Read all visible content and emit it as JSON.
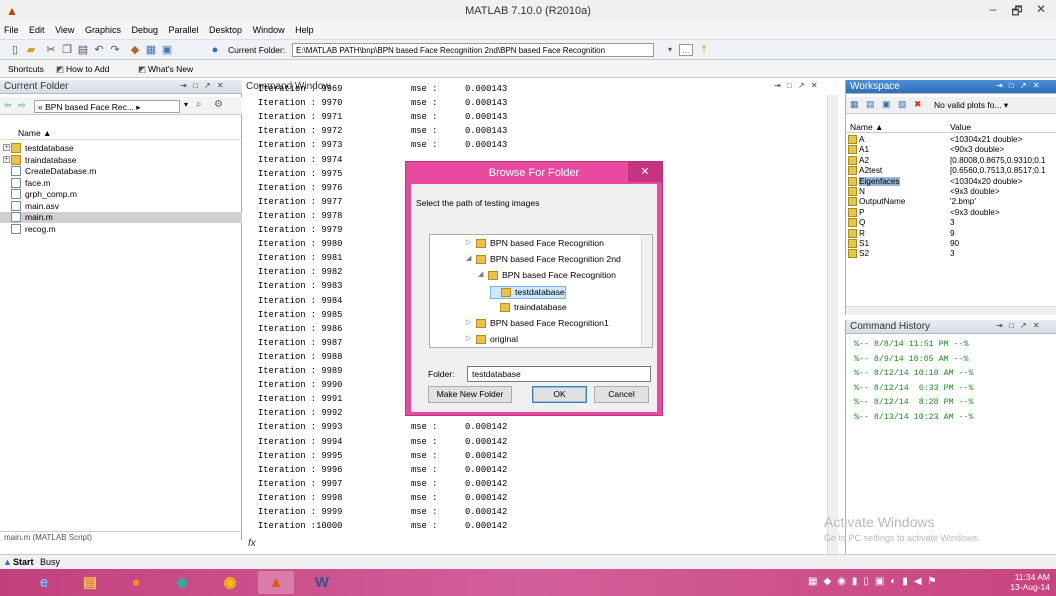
{
  "window": {
    "title": "MATLAB  7.10.0 (R2010a)",
    "controls": [
      "–",
      "🗗",
      "✕"
    ]
  },
  "menu": [
    "File",
    "Edit",
    "View",
    "Graphics",
    "Debug",
    "Parallel",
    "Desktop",
    "Window",
    "Help"
  ],
  "toolbar": {
    "current_folder_label": "Current Folder:",
    "current_folder_value": "E:\\MATLAB PATH\\bnp\\BPN based Face Recognition 2nd\\BPN based Face Recognition",
    "dropdown_icon": "▾",
    "browse_label": "...",
    "up_icon": "⤒"
  },
  "shortcuts": {
    "items": [
      "Shortcuts",
      "How to Add",
      "What's New"
    ]
  },
  "current_folder": {
    "title": "Current Folder",
    "controls": "⇥ □ ↗ ✕",
    "path": "« BPN based Face Rec... ▸",
    "column_name": "Name ▲",
    "files": [
      {
        "name": "testdatabase",
        "type": "folder",
        "expand": "+"
      },
      {
        "name": "traindatabase",
        "type": "folder",
        "expand": "+"
      },
      {
        "name": "CreateDatabase.m",
        "type": "m"
      },
      {
        "name": "face.m",
        "type": "m"
      },
      {
        "name": "grph_comp.m",
        "type": "m"
      },
      {
        "name": "main.asv",
        "type": "asv"
      },
      {
        "name": "main.m",
        "type": "m",
        "selected": true
      },
      {
        "name": "recog.m",
        "type": "m"
      }
    ],
    "status": "main.m (MATLAB Script)"
  },
  "command_window": {
    "title": "Command Window",
    "controls": "⇥ □ ↗ ✕",
    "lines": [
      [
        "Iteration : 9969",
        "mse :",
        "0.000143"
      ],
      [
        "Iteration : 9970",
        "mse :",
        "0.000143"
      ],
      [
        "Iteration : 9971",
        "mse :",
        "0.000143"
      ],
      [
        "Iteration : 9972",
        "mse :",
        "0.000143"
      ],
      [
        "Iteration : 9973",
        "mse :",
        "0.000143"
      ],
      [
        "Iteration : 9974",
        "",
        ""
      ],
      [
        "Iteration : 9975",
        "",
        ""
      ],
      [
        "Iteration : 9976",
        "",
        ""
      ],
      [
        "Iteration : 9977",
        "",
        ""
      ],
      [
        "Iteration : 9978",
        "",
        ""
      ],
      [
        "Iteration : 9979",
        "",
        ""
      ],
      [
        "Iteration : 9980",
        "",
        ""
      ],
      [
        "Iteration : 9981",
        "",
        ""
      ],
      [
        "Iteration : 9982",
        "",
        ""
      ],
      [
        "Iteration : 9983",
        "",
        ""
      ],
      [
        "Iteration : 9984",
        "",
        ""
      ],
      [
        "Iteration : 9985",
        "",
        ""
      ],
      [
        "Iteration : 9986",
        "",
        ""
      ],
      [
        "Iteration : 9987",
        "",
        ""
      ],
      [
        "Iteration : 9988",
        "",
        ""
      ],
      [
        "Iteration : 9989",
        "",
        ""
      ],
      [
        "Iteration : 9990",
        "",
        ""
      ],
      [
        "Iteration : 9991",
        "",
        ""
      ],
      [
        "Iteration : 9992",
        "mse :",
        "0.000142"
      ],
      [
        "Iteration : 9993",
        "mse :",
        "0.000142"
      ],
      [
        "Iteration : 9994",
        "mse :",
        "0.000142"
      ],
      [
        "Iteration : 9995",
        "mse :",
        "0.000142"
      ],
      [
        "Iteration : 9996",
        "mse :",
        "0.000142"
      ],
      [
        "Iteration : 9997",
        "mse :",
        "0.000142"
      ],
      [
        "Iteration : 9998",
        "mse :",
        "0.000142"
      ],
      [
        "Iteration : 9999",
        "mse :",
        "0.000142"
      ],
      [
        "Iteration :10000",
        "mse :",
        "0.000142"
      ]
    ],
    "prompt": "fx"
  },
  "workspace": {
    "title": "Workspace",
    "controls": "⇥ □ ↗ ✕",
    "plot_selector": "No valid plots fo... ▾",
    "col_name": "Name ▲",
    "col_value": "Value",
    "vars": [
      {
        "name": "A",
        "value": "<10304x21 double>"
      },
      {
        "name": "A1",
        "value": "<90x3 double>"
      },
      {
        "name": "A2",
        "value": "[0.8008,0.8675,0.9310;0.1"
      },
      {
        "name": "A2test",
        "value": "[0.6560,0.7513,0.8517;0.1"
      },
      {
        "name": "Eigenfaces",
        "value": "<10304x20 double>",
        "selected": true
      },
      {
        "name": "N",
        "value": "<9x3 double>"
      },
      {
        "name": "OutputName",
        "value": "'2.bmp'"
      },
      {
        "name": "P",
        "value": "<9x3 double>"
      },
      {
        "name": "Q",
        "value": "3"
      },
      {
        "name": "R",
        "value": "9"
      },
      {
        "name": "S1",
        "value": "90"
      },
      {
        "name": "S2",
        "value": "3"
      }
    ]
  },
  "command_history": {
    "title": "Command History",
    "controls": "⇥ □ ↗ ✕",
    "entries": [
      "%-- 8/8/14 11:51 PM --%",
      "%-- 8/9/14 10:05 AM --%",
      "%-- 8/12/14 10:18 AM --%",
      "%-- 8/12/14  6:33 PM --%",
      "%-- 8/12/14  8:28 PM --%",
      "%-- 8/13/14 10:23 AM --%"
    ]
  },
  "dialog": {
    "title": "Browse For Folder",
    "close": "✕",
    "description": "Select the path of testing images",
    "tree": [
      {
        "label": "BPN based Face Recognition",
        "level": 0,
        "arrow": "▷"
      },
      {
        "label": "BPN based Face Recognition 2nd",
        "level": 0,
        "arrow": "◢"
      },
      {
        "label": "BPN based Face Recognition",
        "level": 1,
        "arrow": "◢"
      },
      {
        "label": "testdatabase",
        "level": 2,
        "arrow": "",
        "selected": true
      },
      {
        "label": "traindatabase",
        "level": 2,
        "arrow": ""
      },
      {
        "label": "BPN based Face Recognition1",
        "level": 0,
        "arrow": "▷"
      },
      {
        "label": "original",
        "level": 0,
        "arrow": "▷"
      }
    ],
    "folder_label": "Folder:",
    "folder_value": "testdatabase",
    "make_new_folder": "Make New Folder",
    "ok": "OK",
    "cancel": "Cancel"
  },
  "statusbar": {
    "start": "Start",
    "status": "Busy"
  },
  "watermark": {
    "line1": "Activate Windows",
    "line2": "Go to PC settings to activate Windows."
  },
  "clock": {
    "time": "11:34 AM",
    "date": "13-Aug-14"
  },
  "colors": {
    "accent": "#2e6fba",
    "taskbar": "#c9447f",
    "dialog_border": "#e84aa0",
    "history_text": "#1a8a1a"
  }
}
